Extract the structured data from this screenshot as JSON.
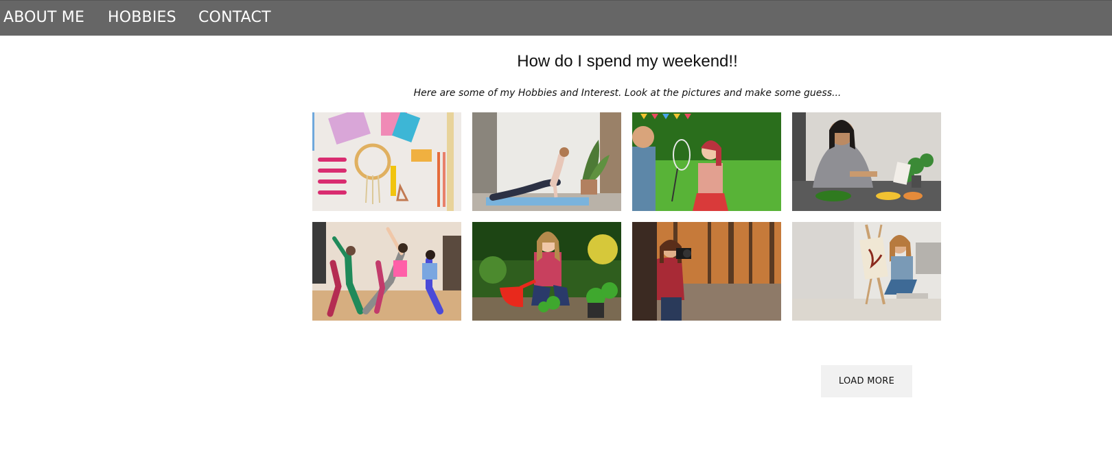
{
  "nav": {
    "items": [
      {
        "label": "ABOUT ME"
      },
      {
        "label": "HOBBIES"
      },
      {
        "label": "CONTACT"
      }
    ]
  },
  "main": {
    "title": "How do I spend my weekend!!",
    "subtitle": "Here are some of my Hobbies and Interest. Look at the pictures and make some guess...",
    "load_more_label": "LOAD MORE"
  },
  "gallery": {
    "images": [
      {
        "icon": "craft-supplies-photo"
      },
      {
        "icon": "yoga-photo"
      },
      {
        "icon": "badminton-photo"
      },
      {
        "icon": "cooking-photo"
      },
      {
        "icon": "dance-photo"
      },
      {
        "icon": "gardening-photo"
      },
      {
        "icon": "photography-photo"
      },
      {
        "icon": "painting-photo"
      }
    ]
  },
  "colors": {
    "nav_bg": "#666666",
    "nav_text": "#ffffff",
    "button_bg": "#f1f1f1"
  }
}
